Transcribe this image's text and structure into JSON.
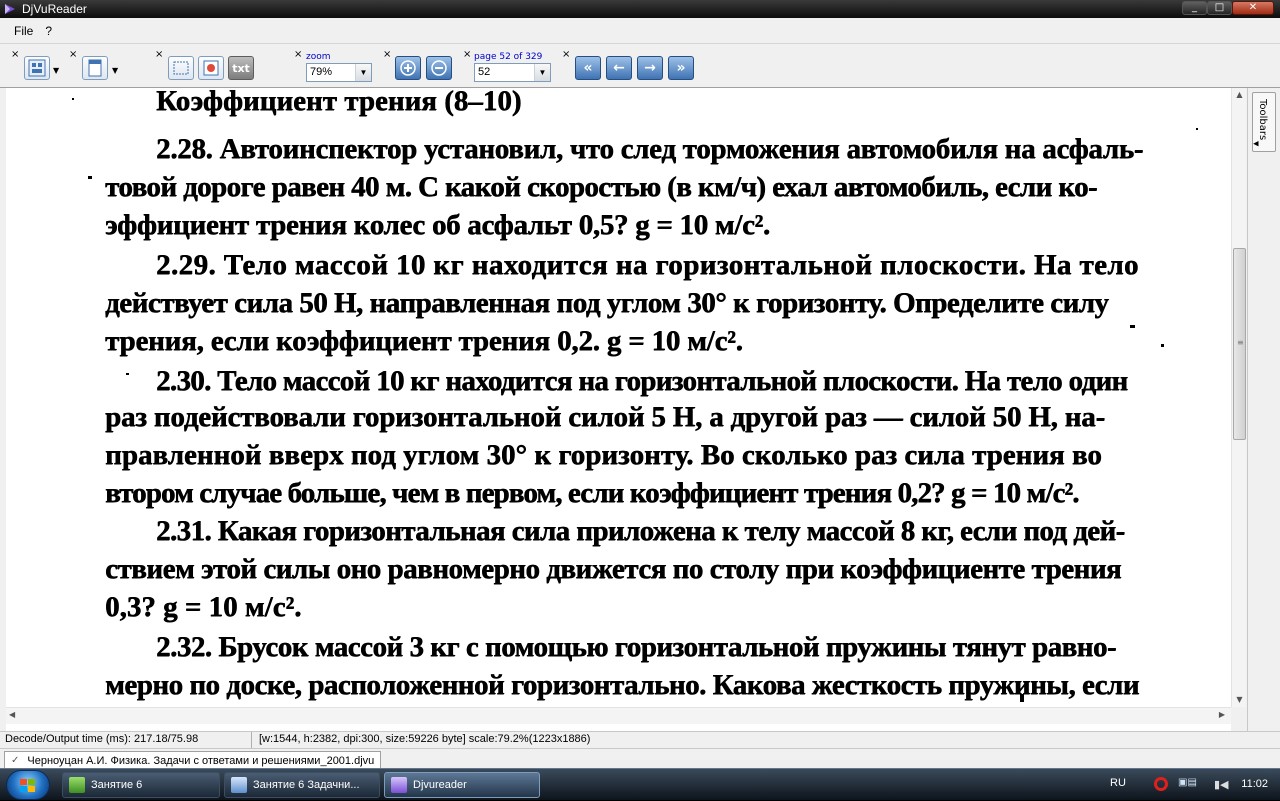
{
  "window": {
    "title": "DjVuReader",
    "min": "_",
    "max": "□",
    "close": "✕"
  },
  "menu": {
    "items": [
      "File",
      "?"
    ]
  },
  "toolbar": {
    "zoom_caption": "zoom",
    "zoom_value": "79%",
    "page_caption": "page 52 of 329",
    "page_value": "52",
    "text_button": "txt",
    "close_glyph": "×"
  },
  "document": {
    "lines": [
      "Коэффициент трения  (8–10)",
      "2.28. Автоинспектор установил, что след торможения автомобиля на асфаль-",
      "товой дороге равен 40 м. С какой скоростью (в км/ч) ехал автомобиль, если ко-",
      "эффициент трения колес об асфальт 0,5? g = 10 м/с².",
      "2.29. Тело массой 10 кг находится на горизонтальной плоскости. На тело",
      "действует сила 50 Н, направленная под углом 30° к горизонту. Определите силу",
      "трения, если коэффициент трения 0,2.  g = 10 м/с².",
      "2.30. Тело массой 10 кг находится на горизонтальной плоскости. На тело один",
      "раз подействовали горизонтальной силой 5 Н, а другой раз — силой 50 Н, на-",
      "правленной вверх под углом 30° к горизонту. Во сколько раз сила трения во",
      "втором случае больше, чем в первом, если коэффициент трения 0,2? g = 10 м/с².",
      "2.31. Какая горизонтальная сила приложена к телу массой 8 кг, если под дей-",
      "ствием этой силы оно равномерно движется по столу при коэффициенте трения",
      "0,3?  g = 10 м/с².",
      "2.32. Брусок массой 3 кг с помощью горизонтальной пружины тянут равно-",
      "мерно по доске, расположенной горизонтально. Какова жесткость пружины, если"
    ]
  },
  "dock": {
    "label": "Toolbars"
  },
  "status": {
    "decode": "Decode/Output time (ms): 217.18/75.98",
    "info": "[w:1544, h:2382, dpi:300, size:59226 byte] scale:79.2%(1223x1886)"
  },
  "file_tab": {
    "label": "Черноуцан А.И. Физика. Задачи с ответами и решениями_2001.djvu"
  },
  "taskbar": {
    "apps": [
      {
        "label": "Занятие 6"
      },
      {
        "label": "Занятие 6 Задачни..."
      },
      {
        "label": "Djvureader"
      }
    ],
    "lang": "RU",
    "time": "11:02"
  },
  "colors": {
    "accent": "#3f73b3",
    "taskbar": "#1c2836"
  }
}
